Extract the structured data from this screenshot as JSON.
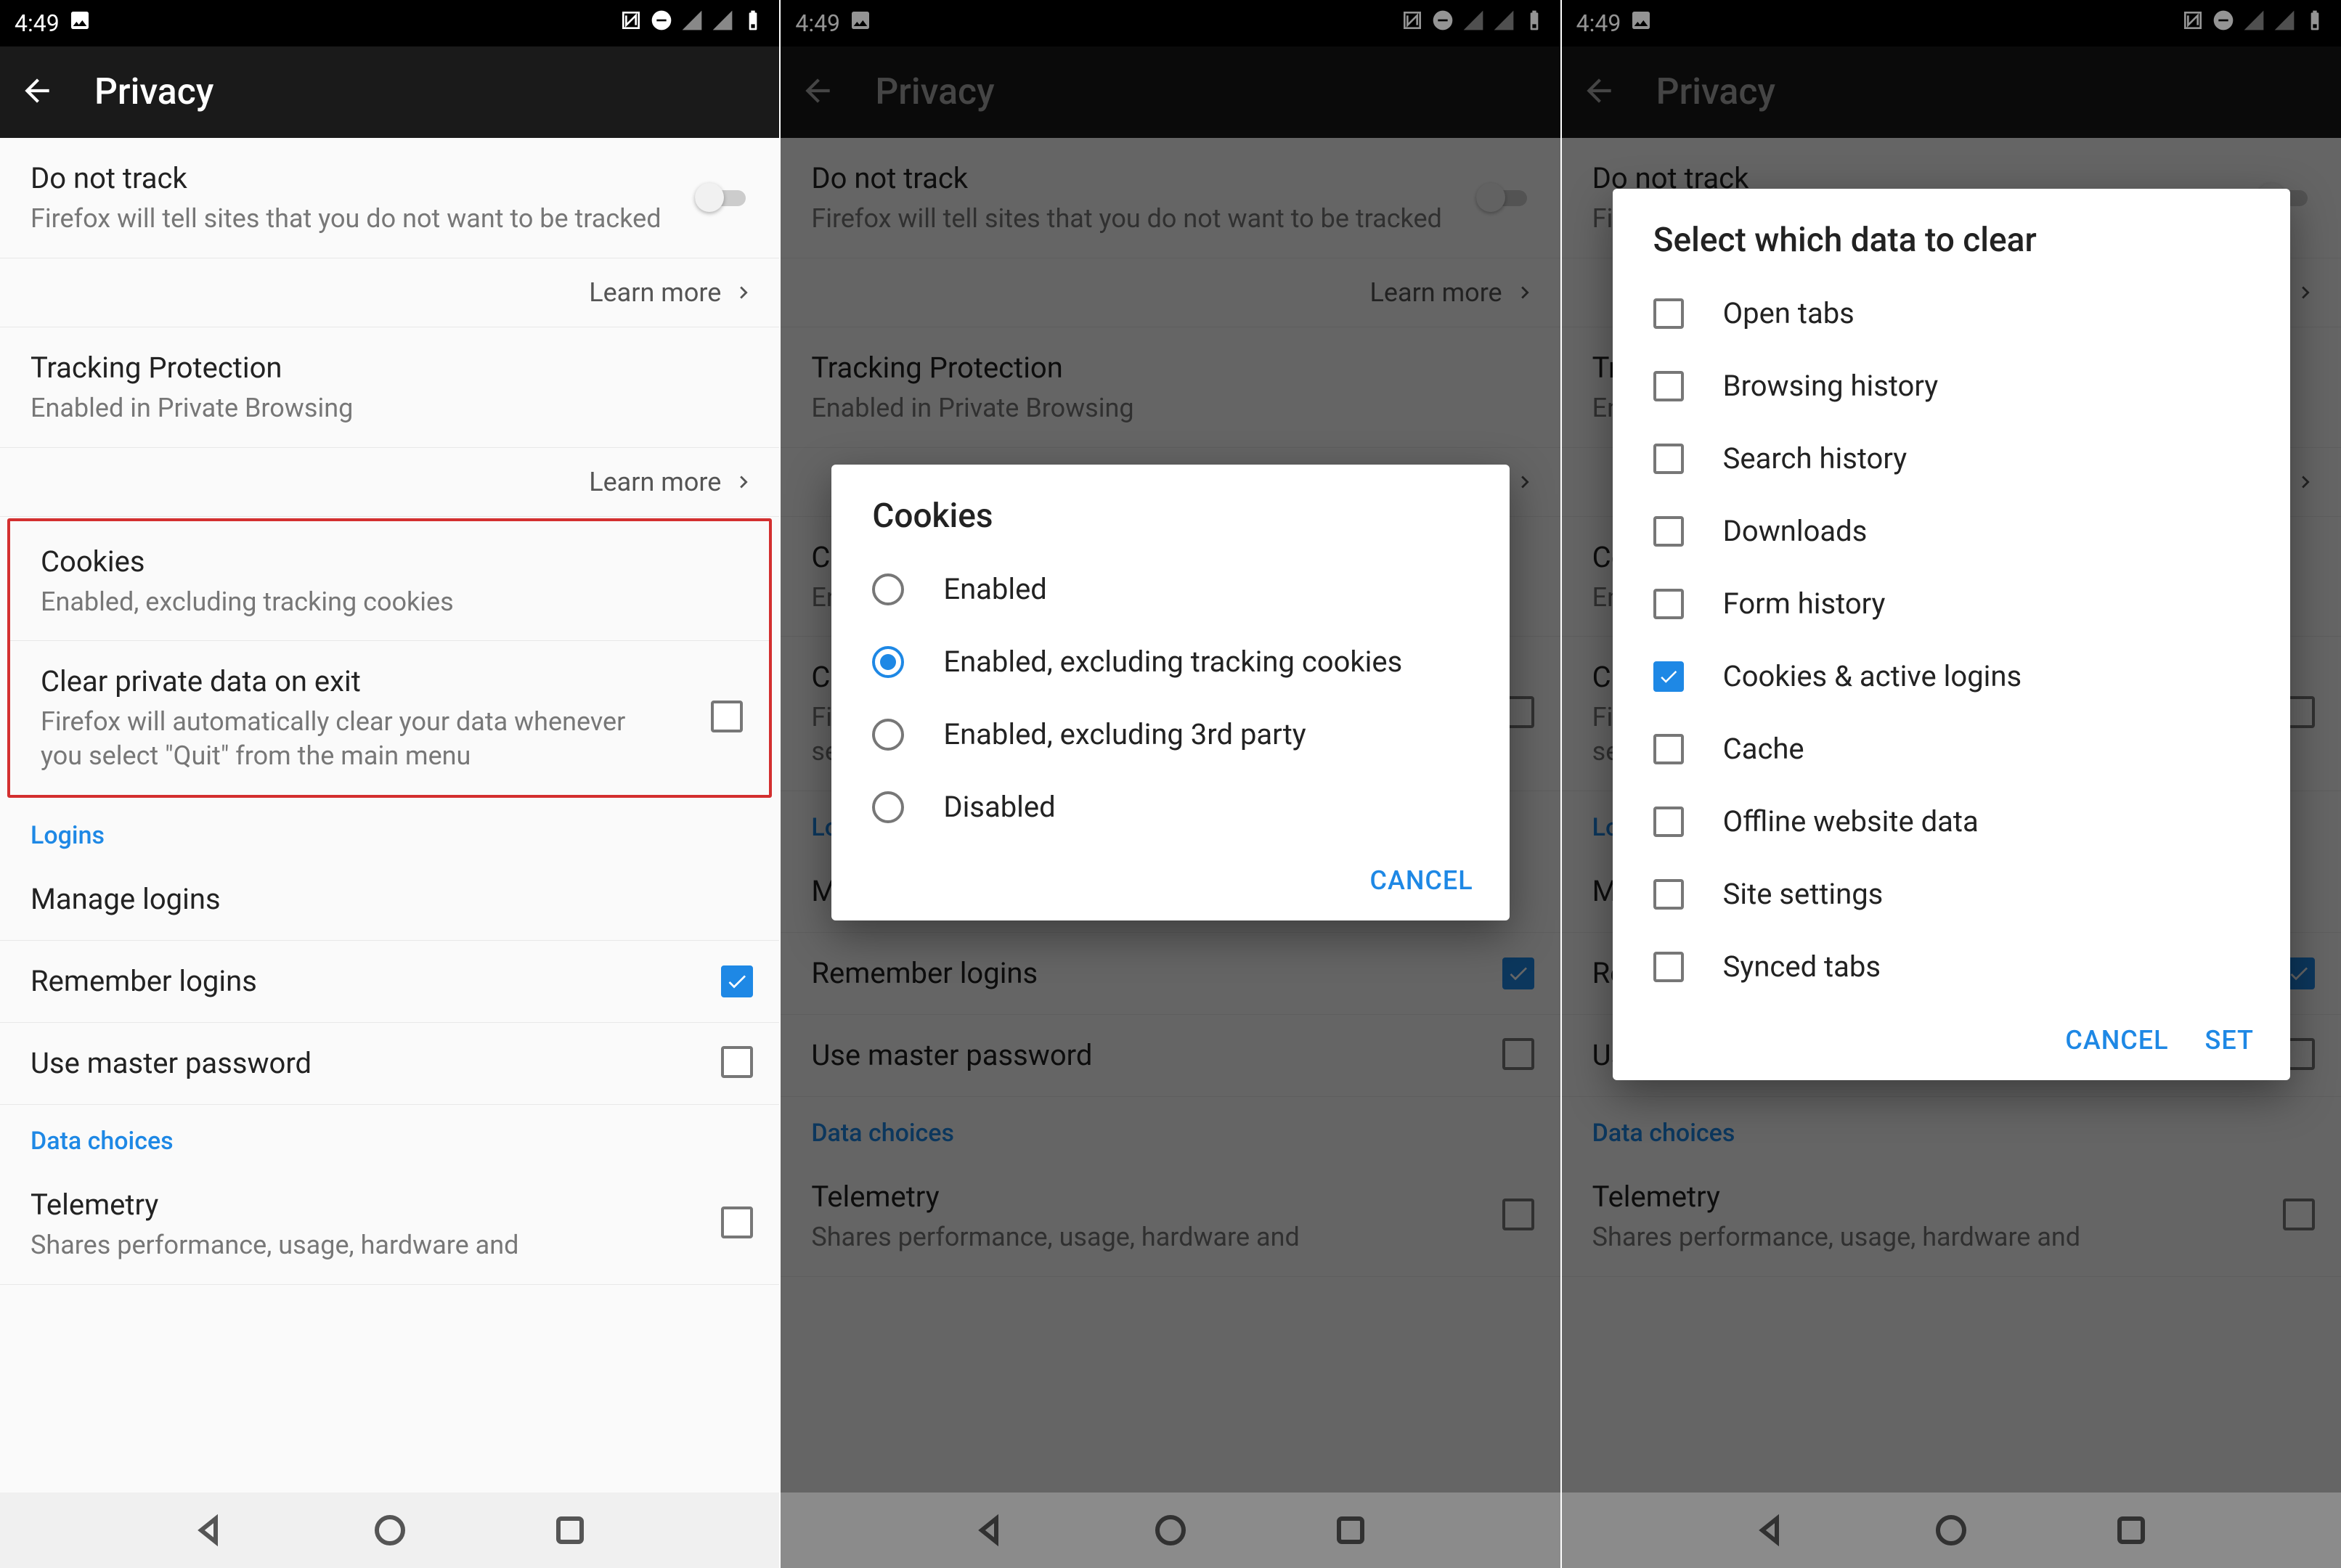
{
  "status": {
    "time": "4:49"
  },
  "appbar": {
    "title": "Privacy"
  },
  "settings": {
    "dnt": {
      "title": "Do not track",
      "sub": "Firefox will tell sites that you do not want to be tracked"
    },
    "learn_more": "Learn more",
    "tracking": {
      "title": "Tracking Protection",
      "sub": "Enabled in Private Browsing"
    },
    "cookies": {
      "title": "Cookies",
      "sub": "Enabled, excluding tracking cookies"
    },
    "clear_exit": {
      "title": "Clear private data on exit",
      "sub": "Firefox will automatically clear your data whenever you select \"Quit\" from the main menu"
    },
    "logins_header": "Logins",
    "manage_logins": "Manage logins",
    "remember_logins": "Remember logins",
    "master_pw": "Use master password",
    "data_choices_header": "Data choices",
    "telemetry": {
      "title": "Telemetry",
      "sub": "Shares performance, usage, hardware and"
    }
  },
  "cookies_dialog": {
    "title": "Cookies",
    "options": [
      "Enabled",
      "Enabled, excluding tracking cookies",
      "Enabled, excluding 3rd party",
      "Disabled"
    ],
    "selected_index": 1,
    "cancel": "CANCEL"
  },
  "clear_dialog": {
    "title": "Select which data to clear",
    "items": [
      {
        "label": "Open tabs",
        "checked": false
      },
      {
        "label": "Browsing history",
        "checked": false
      },
      {
        "label": "Search history",
        "checked": false
      },
      {
        "label": "Downloads",
        "checked": false
      },
      {
        "label": "Form history",
        "checked": false
      },
      {
        "label": "Cookies & active logins",
        "checked": true
      },
      {
        "label": "Cache",
        "checked": false
      },
      {
        "label": "Offline website data",
        "checked": false
      },
      {
        "label": "Site settings",
        "checked": false
      },
      {
        "label": "Synced tabs",
        "checked": false
      }
    ],
    "cancel": "CANCEL",
    "set": "SET"
  }
}
